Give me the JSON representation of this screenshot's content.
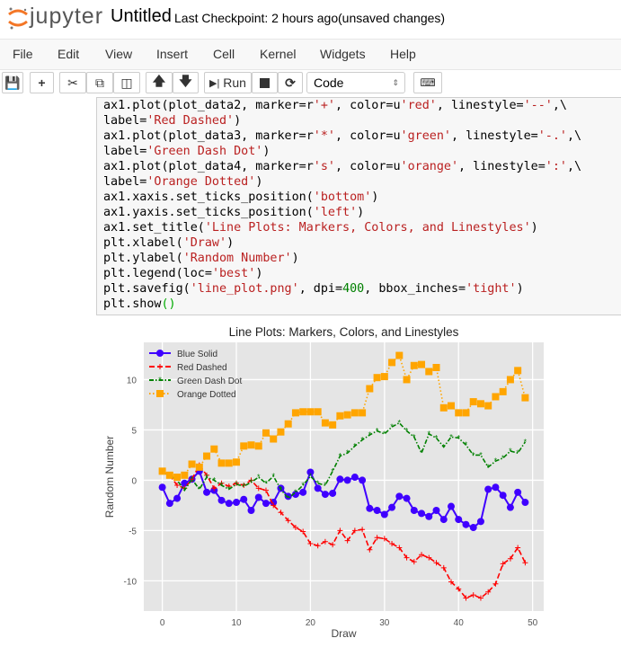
{
  "header": {
    "logo_text": "jupyter",
    "notebook_title": "Untitled",
    "checkpoint": "Last Checkpoint: 2 hours ago",
    "unsaved": "(unsaved changes)"
  },
  "menu": [
    "File",
    "Edit",
    "View",
    "Insert",
    "Cell",
    "Kernel",
    "Widgets",
    "Help"
  ],
  "toolbar": {
    "run_label": "Run",
    "cell_type": "Code",
    "icons": [
      "save-icon",
      "plus-icon",
      "scissors-icon",
      "copy-icon",
      "paste-icon",
      "arrow-up-icon",
      "arrow-down-icon",
      "step-forward-icon",
      "stop-icon",
      "restart-icon",
      "keyboard-icon"
    ]
  },
  "code_lines": [
    [
      [
        "ax1.plot(plot_data2, marker=r",
        ""
      ],
      [
        "'+'",
        "s"
      ],
      [
        ", color=u",
        ""
      ],
      [
        "'red'",
        "s"
      ],
      [
        ", linestyle=",
        ""
      ],
      [
        "'--'",
        "s"
      ],
      [
        ",\\",
        ""
      ]
    ],
    [
      [
        "label=",
        ""
      ],
      [
        "'Red Dashed'",
        "s"
      ],
      [
        ")",
        ""
      ]
    ],
    [
      [
        "ax1.plot(plot_data3, marker=r",
        ""
      ],
      [
        "'*'",
        "s"
      ],
      [
        ", color=u",
        ""
      ],
      [
        "'green'",
        "s"
      ],
      [
        ", linestyle=",
        ""
      ],
      [
        "'-.'",
        "s"
      ],
      [
        ",\\",
        ""
      ]
    ],
    [
      [
        "label=",
        ""
      ],
      [
        "'Green Dash Dot'",
        "s"
      ],
      [
        ")",
        ""
      ]
    ],
    [
      [
        "ax1.plot(plot_data4, marker=r",
        ""
      ],
      [
        "'s'",
        "s"
      ],
      [
        ", color=u",
        ""
      ],
      [
        "'orange'",
        "s"
      ],
      [
        ", linestyle=",
        ""
      ],
      [
        "':'",
        "s"
      ],
      [
        ",\\",
        ""
      ]
    ],
    [
      [
        "label=",
        ""
      ],
      [
        "'Orange Dotted'",
        "s"
      ],
      [
        ")",
        ""
      ]
    ],
    [
      [
        "ax1.xaxis.set_ticks_position(",
        ""
      ],
      [
        "'bottom'",
        "s"
      ],
      [
        ")",
        ""
      ]
    ],
    [
      [
        "ax1.yaxis.set_ticks_position(",
        ""
      ],
      [
        "'left'",
        "s"
      ],
      [
        ")",
        ""
      ]
    ],
    [
      [
        "ax1.set_title(",
        ""
      ],
      [
        "'Line Plots: Markers, Colors, and Linestyles'",
        "s"
      ],
      [
        ")",
        ""
      ]
    ],
    [
      [
        "plt.xlabel(",
        ""
      ],
      [
        "'Draw'",
        "s"
      ],
      [
        ")",
        ""
      ]
    ],
    [
      [
        "plt.ylabel(",
        ""
      ],
      [
        "'Random Number'",
        "s"
      ],
      [
        ")",
        ""
      ]
    ],
    [
      [
        "plt.legend(loc=",
        ""
      ],
      [
        "'best'",
        "s"
      ],
      [
        ")",
        ""
      ]
    ],
    [
      [
        "plt.savefig(",
        ""
      ],
      [
        "'line_plot.png'",
        "s"
      ],
      [
        ", dpi=",
        ""
      ],
      [
        "400",
        "n"
      ],
      [
        ", bbox_inches=",
        ""
      ],
      [
        "'tight'",
        "s"
      ],
      [
        ")",
        ""
      ]
    ],
    [
      [
        "plt.show",
        ""
      ],
      [
        "()",
        "p"
      ]
    ]
  ],
  "chart_data": {
    "type": "line",
    "title": "Line Plots: Markers, Colors, and Linestyles",
    "xlabel": "Draw",
    "ylabel": "Random Number",
    "xlim": [
      -2.5,
      51.5
    ],
    "ylim": [
      -13,
      13.7
    ],
    "xticks": [
      0,
      10,
      20,
      30,
      40,
      50
    ],
    "yticks": [
      -10,
      -5,
      0,
      5,
      10
    ],
    "grid": true,
    "legend_position": "top-left",
    "background": "#e5e5e5",
    "x": [
      0,
      1,
      2,
      3,
      4,
      5,
      6,
      7,
      8,
      9,
      10,
      11,
      12,
      13,
      14,
      15,
      16,
      17,
      18,
      19,
      20,
      21,
      22,
      23,
      24,
      25,
      26,
      27,
      28,
      29,
      30,
      31,
      32,
      33,
      34,
      35,
      36,
      37,
      38,
      39,
      40,
      41,
      42,
      43,
      44,
      45,
      46,
      47,
      48,
      49
    ],
    "series": [
      {
        "name": "Blue Solid",
        "color": "#3f00ff",
        "marker": "circle",
        "linestyle": "solid",
        "values": [
          -0.7,
          -2.3,
          -1.8,
          -0.3,
          0.1,
          0.9,
          -1.2,
          -1.0,
          -2.0,
          -2.3,
          -2.2,
          -1.9,
          -3.0,
          -1.7,
          -2.3,
          -2.2,
          -0.8,
          -1.6,
          -1.4,
          -1.2,
          0.8,
          -0.8,
          -1.4,
          -1.3,
          0.1,
          0.0,
          0.3,
          0.0,
          -2.8,
          -3.0,
          -3.4,
          -2.7,
          -1.6,
          -1.8,
          -3.0,
          -3.3,
          -3.6,
          -3.0,
          -3.9,
          -2.6,
          -3.9,
          -4.4,
          -4.7,
          -4.1,
          -0.9,
          -0.7,
          -1.5,
          -2.7,
          -1.2,
          -2.2
        ]
      },
      {
        "name": "Red Dashed",
        "color": "#ff0000",
        "marker": "plus",
        "linestyle": "dashed",
        "values": [
          0.9,
          0.5,
          -0.5,
          -0.8,
          0.1,
          1.5,
          0.5,
          -0.8,
          -0.3,
          -0.6,
          -0.3,
          -0.5,
          0.0,
          -0.8,
          -1.0,
          -2.5,
          -3.2,
          -4.0,
          -4.7,
          -5.1,
          -6.3,
          -6.5,
          -6.1,
          -6.4,
          -5.0,
          -6.0,
          -5.0,
          -4.9,
          -6.9,
          -5.7,
          -5.8,
          -6.3,
          -6.7,
          -7.7,
          -8.1,
          -7.4,
          -7.7,
          -8.2,
          -8.7,
          -10.1,
          -10.8,
          -11.7,
          -11.4,
          -11.7,
          -11.1,
          -10.3,
          -8.3,
          -7.8,
          -6.7,
          -8.2
        ]
      },
      {
        "name": "Green Dash Dot",
        "color": "#008000",
        "marker": "star",
        "linestyle": "dashdot",
        "values": [
          0.8,
          0.5,
          0.0,
          -1.0,
          0.1,
          -0.9,
          0.3,
          0.0,
          -0.5,
          -0.9,
          -0.4,
          -0.6,
          -0.2,
          0.3,
          -0.3,
          0.4,
          -0.9,
          -1.8,
          -1.2,
          -0.5,
          0.4,
          -0.3,
          -0.5,
          0.9,
          2.4,
          2.7,
          3.4,
          4.0,
          4.5,
          4.9,
          4.6,
          5.3,
          5.7,
          4.9,
          4.3,
          2.7,
          4.6,
          4.2,
          3.3,
          4.3,
          4.2,
          3.5,
          2.5,
          2.5,
          1.3,
          1.9,
          2.2,
          2.9,
          2.7,
          3.8
        ]
      },
      {
        "name": "Orange Dotted",
        "color": "#ffa500",
        "marker": "square",
        "linestyle": "dotted",
        "values": [
          0.9,
          0.5,
          0.3,
          0.5,
          1.6,
          1.3,
          2.4,
          3.1,
          1.7,
          1.7,
          1.8,
          3.4,
          3.5,
          3.4,
          4.7,
          4.1,
          4.8,
          5.6,
          6.7,
          6.8,
          6.8,
          6.8,
          5.7,
          5.5,
          6.4,
          6.5,
          6.7,
          6.7,
          9.1,
          10.2,
          10.3,
          11.7,
          12.4,
          10.0,
          11.4,
          11.5,
          10.8,
          11.2,
          7.2,
          7.4,
          6.7,
          6.7,
          7.8,
          7.6,
          7.4,
          8.3,
          8.8,
          10.0,
          10.9,
          8.2
        ]
      }
    ]
  }
}
